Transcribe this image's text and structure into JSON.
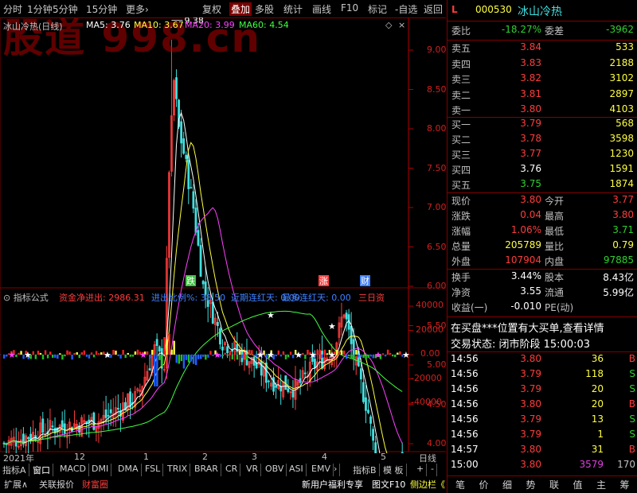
{
  "toolbar": {
    "left_items": [
      "分时",
      "1分钟",
      "5分钟",
      "15分钟",
      "更多›"
    ],
    "right_items": [
      "复权",
      "叠加",
      "多股",
      "统计",
      "画线",
      "F10",
      "标记",
      "-自选",
      "返回"
    ]
  },
  "watermark": "股道 998.cn",
  "chart": {
    "title": "冰山冷热(日线)",
    "ma5_label": "MA5: 3.76",
    "ma10_label": "MA10: 3.67",
    "ma20_label": "MA20: 3.99",
    "ma60_label": "MA60: 4.54",
    "high_marker": "9.38",
    "low_marker": "3.27",
    "tags": [
      "跌",
      "涨",
      "财"
    ],
    "y_ticks": [
      "9.00",
      "8.50",
      "8.00",
      "7.50",
      "7.00",
      "6.50",
      "6.00",
      "5.50",
      "5.00",
      "4.50",
      "4.00"
    ],
    "colors": {
      "up": "#ff3c3c",
      "down": "#40e0e0",
      "ma5": "#ffffff",
      "ma10": "#ffff40",
      "ma20": "#ff40ff",
      "ma60": "#40ff40"
    }
  },
  "indicator": {
    "title": "指标公式",
    "fields": [
      {
        "label": "资金净进出: 2986.31",
        "color": "#ff3c3c"
      },
      {
        "label": "进出比例%: 38.50",
        "color": "#4080ff"
      },
      {
        "label": "近期连红天: 0.00",
        "color": "#4080ff"
      },
      {
        "label": "最多连红天: 0.00",
        "color": "#4080ff"
      },
      {
        "label": "三日资",
        "color": "#ff3c3c"
      }
    ],
    "y_ticks": [
      "40000",
      "20000",
      "0.00",
      "-20000",
      "-40000"
    ]
  },
  "x_axis": {
    "labels": [
      "2021年",
      "12",
      "1",
      "2",
      "3",
      "4",
      "5"
    ],
    "period": "日线"
  },
  "bottom_tabs": [
    "指标A",
    "窗口",
    "MACD",
    "DMI",
    "DMA",
    "FSL",
    "TRIX",
    "BRAR",
    "CR",
    "VR",
    "OBV",
    "ASI",
    "EMV",
    "›",
    "指标B",
    "模 板",
    "+",
    "-"
  ],
  "status_bar": {
    "left": [
      "扩展∧",
      "关联报价",
      "财富圈"
    ],
    "right": [
      "新用户福利专享",
      "图文F10",
      "侧边栏《"
    ]
  },
  "quote": {
    "flag": "L",
    "code": "000530",
    "name": "冰山冷热",
    "weibi_label": "委比",
    "weibi": "-18.27%",
    "weicha_label": "委差",
    "weicha": "-3962",
    "asks": [
      {
        "label": "卖五",
        "price": "3.84",
        "vol": "533"
      },
      {
        "label": "卖四",
        "price": "3.83",
        "vol": "2188"
      },
      {
        "label": "卖三",
        "price": "3.82",
        "vol": "3102"
      },
      {
        "label": "卖二",
        "price": "3.81",
        "vol": "2897"
      },
      {
        "label": "卖一",
        "price": "3.80",
        "vol": "4103"
      }
    ],
    "bids": [
      {
        "label": "买一",
        "price": "3.79",
        "vol": "568",
        "pc": "red"
      },
      {
        "label": "买二",
        "price": "3.78",
        "vol": "3598",
        "pc": "red"
      },
      {
        "label": "买三",
        "price": "3.77",
        "vol": "1230",
        "pc": "red"
      },
      {
        "label": "买四",
        "price": "3.76",
        "vol": "1591",
        "pc": "wht"
      },
      {
        "label": "买五",
        "price": "3.75",
        "vol": "1874",
        "pc": "grn"
      }
    ],
    "stats": [
      {
        "l1": "现价",
        "v1": "3.80",
        "c1": "red",
        "l2": "今开",
        "v2": "3.77",
        "c2": "red"
      },
      {
        "l1": "涨跌",
        "v1": "0.04",
        "c1": "red",
        "l2": "最高",
        "v2": "3.80",
        "c2": "red"
      },
      {
        "l1": "涨幅",
        "v1": "1.06%",
        "c1": "red",
        "l2": "最低",
        "v2": "3.71",
        "c2": "grn"
      },
      {
        "l1": "总量",
        "v1": "205789",
        "c1": "yel",
        "l2": "量比",
        "v2": "0.79",
        "c2": "yel"
      },
      {
        "l1": "外盘",
        "v1": "107904",
        "c1": "red",
        "l2": "内盘",
        "v2": "97885",
        "c2": "grn"
      }
    ],
    "stats2": [
      {
        "l1": "换手",
        "v1": "3.44%",
        "l2": "股本",
        "v2": "8.43亿"
      },
      {
        "l1": "净资",
        "v1": "3.55",
        "l2": "流通",
        "v2": "5.99亿"
      },
      {
        "l1": "收益(一)",
        "v1": "-0.010",
        "l2": "PE(动)",
        "v2": ""
      }
    ],
    "notice": "在买盘***位置有大买单,查看详情",
    "trade_status": "交易状态: 闭市阶段 15:00:03",
    "ticks": [
      {
        "t": "14:56",
        "p": "3.80",
        "v": "36",
        "d": "B"
      },
      {
        "t": "14:56",
        "p": "3.79",
        "v": "118",
        "d": "S"
      },
      {
        "t": "14:56",
        "p": "3.79",
        "v": "20",
        "d": "S"
      },
      {
        "t": "14:56",
        "p": "3.80",
        "v": "20",
        "d": "B"
      },
      {
        "t": "14:56",
        "p": "3.79",
        "v": "13",
        "d": "S"
      },
      {
        "t": "14:56",
        "p": "3.79",
        "v": "1",
        "d": "S"
      },
      {
        "t": "14:57",
        "p": "3.80",
        "v": "31",
        "d": "B"
      },
      {
        "t": "15:00",
        "p": "3.80",
        "v": "3579",
        "d": "170"
      }
    ],
    "bottom_tabs": [
      "笔",
      "价",
      "细",
      "势",
      "联",
      "值",
      "主",
      "筹"
    ]
  }
}
